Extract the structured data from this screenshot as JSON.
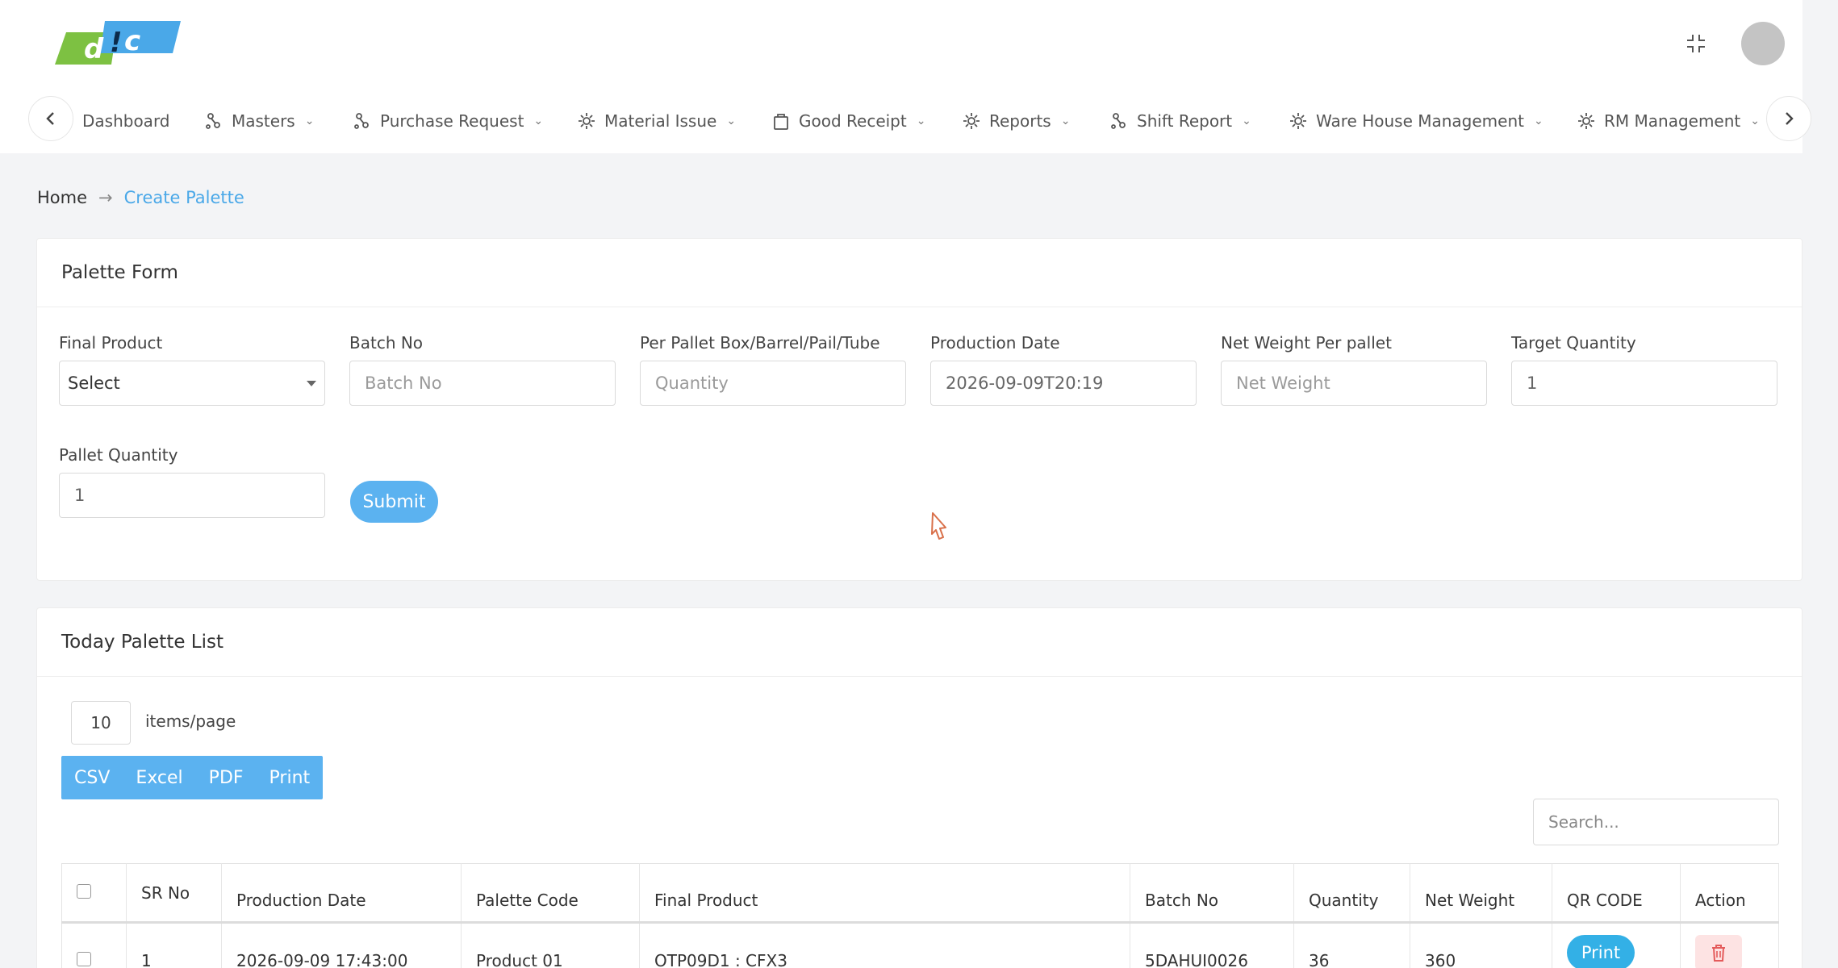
{
  "brand": {
    "logo_text": "d!c",
    "logo_green": "#7dc142",
    "logo_blue": "#4aa8e8"
  },
  "nav": {
    "items": [
      {
        "label": "Dashboard",
        "icon": "dashboard-icon"
      },
      {
        "label": "Masters",
        "icon": "nodes-icon"
      },
      {
        "label": "Purchase Request",
        "icon": "nodes-icon"
      },
      {
        "label": "Material Issue",
        "icon": "gear-icon"
      },
      {
        "label": "Good Receipt",
        "icon": "bag-icon"
      },
      {
        "label": "Reports",
        "icon": "gear-icon"
      },
      {
        "label": "Shift Report",
        "icon": "nodes-icon"
      },
      {
        "label": "Ware House Management",
        "icon": "gear-icon"
      },
      {
        "label": "RM Management",
        "icon": "gear-icon"
      }
    ]
  },
  "breadcrumb": {
    "home": "Home",
    "separator": "→",
    "current": "Create Palette"
  },
  "form": {
    "title": "Palette Form",
    "final_product": {
      "label": "Final Product",
      "value": "Select"
    },
    "batch_no": {
      "label": "Batch No",
      "placeholder": "Batch No"
    },
    "per_pallet": {
      "label": "Per Pallet Box/Barrel/Pail/Tube",
      "placeholder": "Quantity"
    },
    "production_date": {
      "label": "Production Date",
      "value": "2026-09-09T20:19"
    },
    "net_weight": {
      "label": "Net Weight Per pallet",
      "placeholder": "Net Weight"
    },
    "target_quantity": {
      "label": "Target Quantity",
      "value": "1"
    },
    "pallet_quantity": {
      "label": "Pallet Quantity",
      "value": "1"
    },
    "submit_label": "Submit"
  },
  "list": {
    "title": "Today Palette List",
    "page_size": "10",
    "page_size_label": "items/page",
    "export_buttons": [
      "CSV",
      "Excel",
      "PDF",
      "Print"
    ],
    "search_placeholder": "Search...",
    "columns": [
      "SR No",
      "Production Date",
      "Palette Code",
      "Final Product",
      "Batch No",
      "Quantity",
      "Net Weight",
      "QR CODE",
      "Action"
    ],
    "rows": [
      {
        "sr_no": "1",
        "production_date": "2026-09-09 17:43:00",
        "palette_code": "Product 01",
        "final_product": "OTP09D1 : CFX3",
        "batch_no": "5DAHUI0026",
        "quantity": "36",
        "net_weight": "360",
        "qr_label": "Print"
      }
    ]
  },
  "colors": {
    "accent": "#5bb2f0",
    "danger_bg": "#fde3e3",
    "danger": "#e45b5b"
  }
}
